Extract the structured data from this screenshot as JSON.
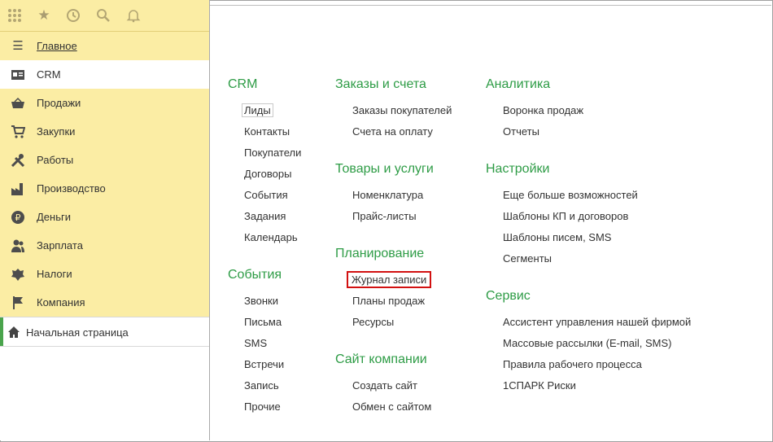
{
  "topbar": {
    "icons": [
      "apps-grid-icon",
      "star-icon",
      "history-icon",
      "search-icon",
      "bell-icon"
    ]
  },
  "sidebar": {
    "items": [
      {
        "label": "Главное",
        "icon": "menu-icon",
        "active": false,
        "main": true
      },
      {
        "label": "CRM",
        "icon": "contact-card-icon",
        "active": true
      },
      {
        "label": "Продажи",
        "icon": "basket-icon",
        "active": false
      },
      {
        "label": "Закупки",
        "icon": "cart-icon",
        "active": false
      },
      {
        "label": "Работы",
        "icon": "tools-icon",
        "active": false
      },
      {
        "label": "Производство",
        "icon": "factory-icon",
        "active": false
      },
      {
        "label": "Деньги",
        "icon": "ruble-icon",
        "active": false
      },
      {
        "label": "Зарплата",
        "icon": "people-icon",
        "active": false
      },
      {
        "label": "Налоги",
        "icon": "emblem-icon",
        "active": false
      },
      {
        "label": "Компания",
        "icon": "flag-icon",
        "active": false
      }
    ],
    "open_tab": {
      "label": "Начальная страница",
      "icon": "home-icon"
    }
  },
  "content": {
    "columns": [
      {
        "groups": [
          {
            "title": "CRM",
            "links": [
              "Лиды",
              "Контакты",
              "Покупатели",
              "Договоры",
              "События",
              "Задания",
              "Календарь"
            ]
          },
          {
            "title": "События",
            "links": [
              "Звонки",
              "Письма",
              "SMS",
              "Встречи",
              "Запись",
              "Прочие"
            ]
          }
        ]
      },
      {
        "groups": [
          {
            "title": "Заказы и счета",
            "links": [
              "Заказы покупателей",
              "Счета на оплату"
            ]
          },
          {
            "title": "Товары и услуги",
            "links": [
              "Номенклатура",
              "Прайс-листы"
            ]
          },
          {
            "title": "Планирование",
            "links": [
              "Журнал записи",
              "Планы продаж",
              "Ресурсы"
            ]
          },
          {
            "title": "Сайт компании",
            "links": [
              "Создать сайт",
              "Обмен с сайтом"
            ]
          }
        ]
      },
      {
        "groups": [
          {
            "title": "Аналитика",
            "links": [
              "Воронка продаж",
              "Отчеты"
            ]
          },
          {
            "title": "Настройки",
            "links": [
              "Еще больше возможностей",
              "Шаблоны КП и договоров",
              "Шаблоны писем, SMS",
              "Сегменты"
            ]
          },
          {
            "title": "Сервис",
            "links": [
              "Ассистент управления нашей фирмой",
              "Массовые рассылки (E-mail, SMS)",
              "Правила рабочего процесса",
              "1СПАРК Риски"
            ]
          }
        ]
      }
    ],
    "selected_link": "Лиды",
    "highlighted_link": "Журнал записи",
    "colors": {
      "group_title": "#2e9c46",
      "sidebar_bg": "#fbeda4",
      "highlight_border": "#d21111",
      "active_marker": "#4aa44c"
    }
  }
}
